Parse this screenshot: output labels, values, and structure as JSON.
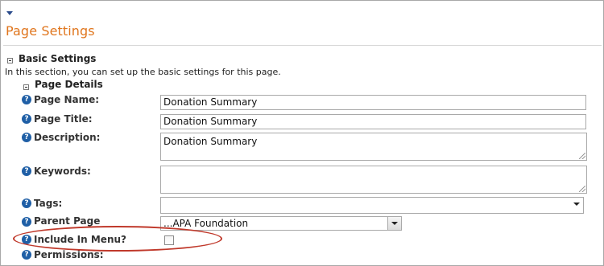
{
  "page": {
    "title": "Page Settings"
  },
  "basic_settings": {
    "heading": "Basic Settings",
    "description": "In this section, you can set up the basic settings for this page."
  },
  "page_details": {
    "heading": "Page Details",
    "fields": {
      "page_name": {
        "label": "Page Name:",
        "value": "Donation Summary"
      },
      "page_title": {
        "label": "Page Title:",
        "value": "Donation Summary"
      },
      "description": {
        "label": "Description:",
        "value": "Donation Summary"
      },
      "keywords": {
        "label": "Keywords:",
        "value": ""
      },
      "tags": {
        "label": "Tags:",
        "value": ""
      },
      "parent_page": {
        "label": "Parent Page",
        "value": "...APA Foundation"
      },
      "include_in_menu": {
        "label": "Include In Menu?",
        "checked": false
      },
      "permissions": {
        "label": "Permissions:"
      }
    }
  },
  "icons": {
    "help": "?",
    "collapse": "chevron-down-icon",
    "section_toggle": "minus-box-icon"
  },
  "colors": {
    "title": "#e0761e",
    "help_icon": "#1f5fa6",
    "highlight": "#c0392b"
  }
}
